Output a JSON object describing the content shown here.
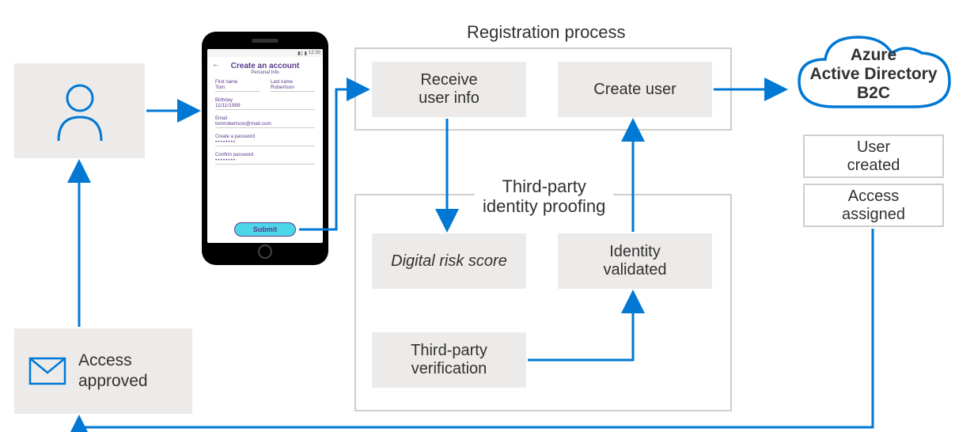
{
  "user": {
    "iconName": "user-icon"
  },
  "accessApproved": {
    "iconName": "envelope-icon",
    "label": "Access\napproved"
  },
  "phone": {
    "statusTime": "12:30",
    "title": "Create an account",
    "subtitle": "Personal Info",
    "fields": {
      "firstNameLabel": "First name",
      "firstNameValue": "Tom",
      "lastNameLabel": "Last name",
      "lastNameValue": "Robertson",
      "birthdayLabel": "Birthday",
      "birthdayValue": "11/11/1989",
      "emailLabel": "Email",
      "emailValue": "tomrobertson@mail.com",
      "passwordLabel": "Create a password",
      "passwordValue": "••••••••",
      "confirmLabel": "Confirm password",
      "confirmValue": "••••••••"
    },
    "submitLabel": "Submit"
  },
  "registration": {
    "title": "Registration process",
    "receive": "Receive\nuser info",
    "createUser": "Create user"
  },
  "thirdParty": {
    "title": "Third-party\nidentity proofing",
    "digitalRisk": "Digital risk score",
    "identityValidated": "Identity\nvalidated",
    "verification": "Third-party\nverification"
  },
  "azure": {
    "title": "Azure\nActive Directory\nB2C",
    "userCreated": "User\ncreated",
    "accessAssigned": "Access\nassigned"
  }
}
